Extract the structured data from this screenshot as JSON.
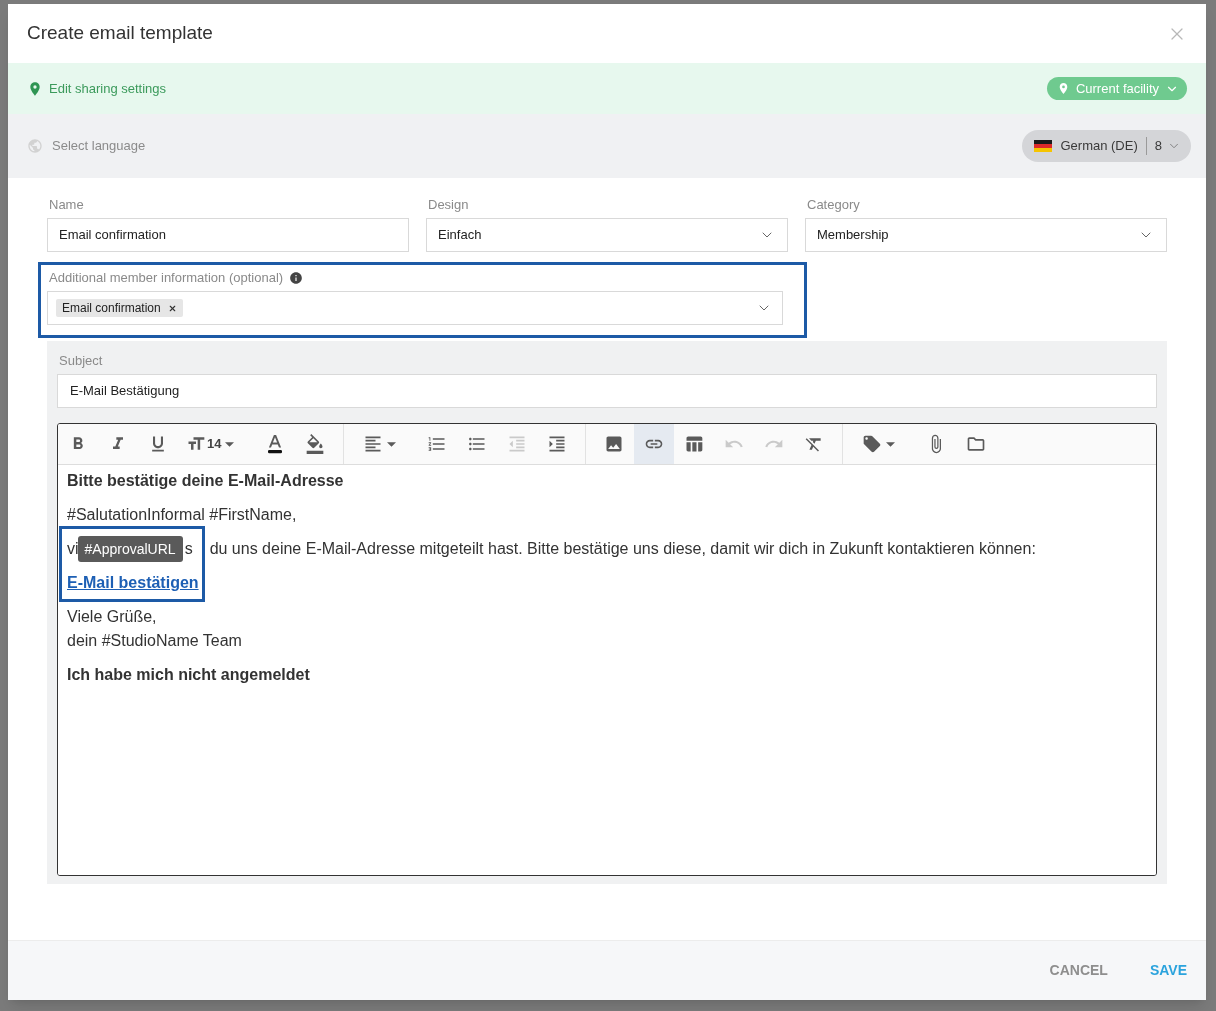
{
  "dialog": {
    "title": "Create email template"
  },
  "sharing": {
    "link": "Edit sharing settings",
    "scope": "Current facility"
  },
  "language": {
    "label": "Select language",
    "value": "German (DE)",
    "count": "8"
  },
  "fields": [
    {
      "kind": "text",
      "label": "Name",
      "value": "Email confirmation"
    },
    {
      "kind": "select",
      "label": "Design",
      "value": "Einfach"
    },
    {
      "kind": "select",
      "label": "Category",
      "value": "Membership"
    }
  ],
  "member_info": {
    "label": "Additional member information (optional)",
    "chips": [
      "Email confirmation"
    ],
    "highlighted": true
  },
  "subject": {
    "label": "Subject",
    "value": "E-Mail Bestätigung"
  },
  "editor": {
    "toolbar": [
      {
        "tools": [
          {
            "kind": "bold",
            "active": false,
            "disabled": false,
            "menu": false
          },
          {
            "kind": "italic",
            "active": false,
            "disabled": false,
            "menu": false
          },
          {
            "kind": "underline",
            "active": false,
            "disabled": false,
            "menu": false
          },
          {
            "kind": "font-size",
            "label": "14",
            "active": false,
            "disabled": false,
            "menu": true
          },
          {
            "kind": "text-color",
            "active": false,
            "disabled": false,
            "menu": false
          },
          {
            "kind": "fill-color",
            "active": false,
            "disabled": false,
            "menu": false
          }
        ]
      },
      {
        "tools": [
          {
            "kind": "align",
            "active": false,
            "disabled": false,
            "menu": true
          },
          {
            "kind": "numbered-list",
            "active": false,
            "disabled": false,
            "menu": false
          },
          {
            "kind": "bullet-list",
            "active": false,
            "disabled": false,
            "menu": false
          },
          {
            "kind": "outdent",
            "active": false,
            "disabled": true,
            "menu": false
          },
          {
            "kind": "indent",
            "active": false,
            "disabled": false,
            "menu": false
          }
        ]
      },
      {
        "tools": [
          {
            "kind": "image",
            "active": false,
            "disabled": false,
            "menu": false
          },
          {
            "kind": "link",
            "active": true,
            "disabled": false,
            "menu": false
          },
          {
            "kind": "table",
            "active": false,
            "disabled": false,
            "menu": false
          },
          {
            "kind": "undo",
            "active": false,
            "disabled": true,
            "menu": false
          },
          {
            "kind": "redo",
            "active": false,
            "disabled": true,
            "menu": false
          },
          {
            "kind": "clear-format",
            "active": false,
            "disabled": false,
            "menu": false
          }
        ]
      },
      {
        "tools": [
          {
            "kind": "tag",
            "active": false,
            "disabled": false,
            "menu": true
          },
          {
            "kind": "attach",
            "active": false,
            "disabled": false,
            "menu": false
          },
          {
            "kind": "folder",
            "active": false,
            "disabled": false,
            "menu": false
          }
        ]
      }
    ],
    "content": [
      {
        "kind": "bold",
        "text": "Bitte bestätige deine E-Mail-Adresse"
      },
      {
        "kind": "plain",
        "text": "#SalutationInformal #FirstName,"
      },
      {
        "kind": "covered",
        "before": "vi",
        "tooltip": "#ApprovalURL",
        "between": "s",
        "after": "du uns deine E-Mail-Adresse mitgeteilt hast. Bitte bestätige uns diese, damit wir dich in Zukunft kontaktieren können:"
      },
      {
        "kind": "link",
        "text": "E-Mail bestätigen",
        "highlighted": true
      },
      {
        "kind": "lines",
        "lines": [
          "Viele Grüße,",
          "dein #StudioName Team"
        ]
      },
      {
        "kind": "bold",
        "text": "Ich habe mich nicht angemeldet"
      }
    ]
  },
  "footer": {
    "buttons": [
      {
        "kind": "secondary",
        "label": "CANCEL"
      },
      {
        "kind": "primary",
        "label": "SAVE"
      }
    ]
  }
}
